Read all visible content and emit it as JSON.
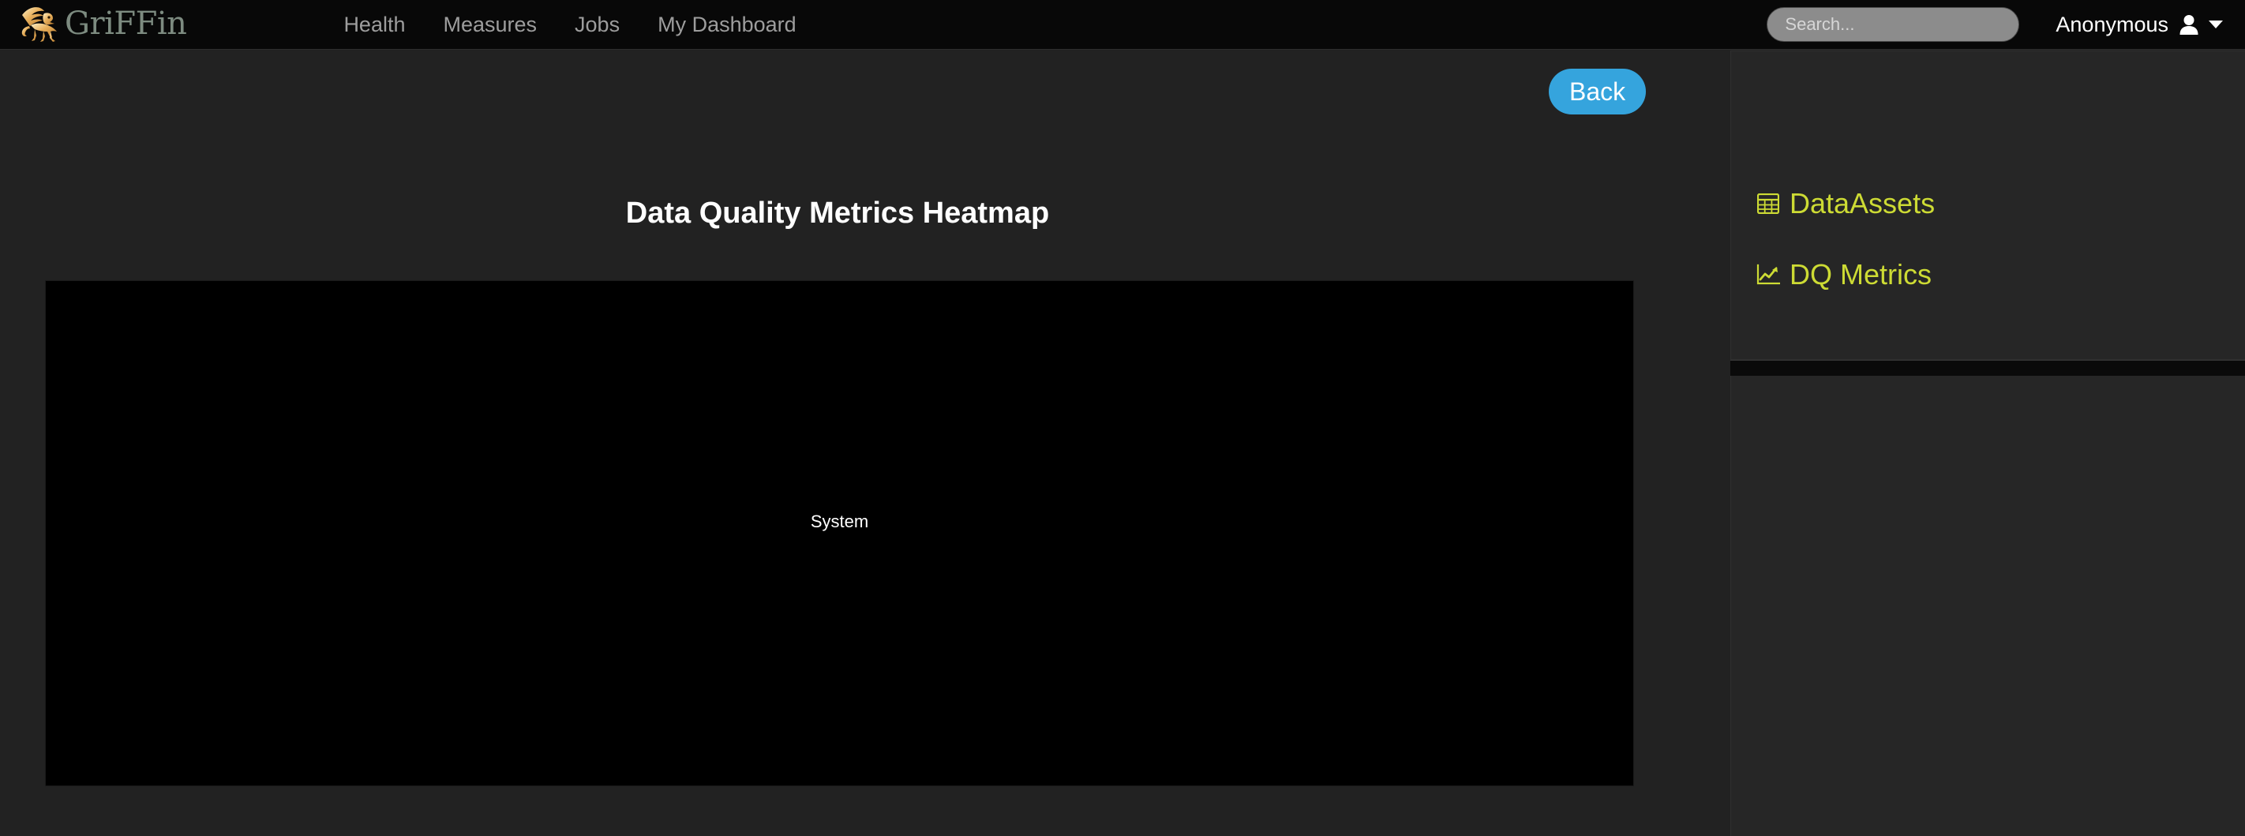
{
  "navbar": {
    "brand": {
      "logo_icon": "griffin-logo-icon",
      "text": "GriFFin",
      "logo_color": "#e8b05c",
      "text_color": "#7d8b80"
    },
    "links": [
      {
        "label": "Health"
      },
      {
        "label": "Measures"
      },
      {
        "label": "Jobs"
      },
      {
        "label": "My Dashboard"
      }
    ],
    "search": {
      "icon": "search-icon",
      "placeholder": "Search...",
      "value": ""
    },
    "user": {
      "name": "Anonymous",
      "icon": "user-person-icon",
      "caret_icon": "chevron-down-icon"
    }
  },
  "main": {
    "back_button": {
      "label": "Back",
      "color": "#35a4dd"
    },
    "title": "Data Quality Metrics Heatmap",
    "heatmap": {
      "label": "System",
      "background": "#000000"
    }
  },
  "sidebar": {
    "items": [
      {
        "label": "DataAssets",
        "icon": "table-grid-icon",
        "color": "#cddb34"
      },
      {
        "label": "DQ Metrics",
        "icon": "line-chart-icon",
        "color": "#cddb34"
      }
    ]
  },
  "chart_data": {
    "type": "heatmap",
    "title": "Data Quality Metrics Heatmap",
    "xlabel": "",
    "ylabel": "",
    "x_categories": [],
    "y_categories": [],
    "values": [],
    "annotations": [
      "System"
    ],
    "grid": false,
    "legend": "none",
    "plot_background": "#000000",
    "note": "Heatmap plot area rendered empty (black) with single centered text label 'System'; no axis ticks, no colorbar, no cells drawn."
  }
}
